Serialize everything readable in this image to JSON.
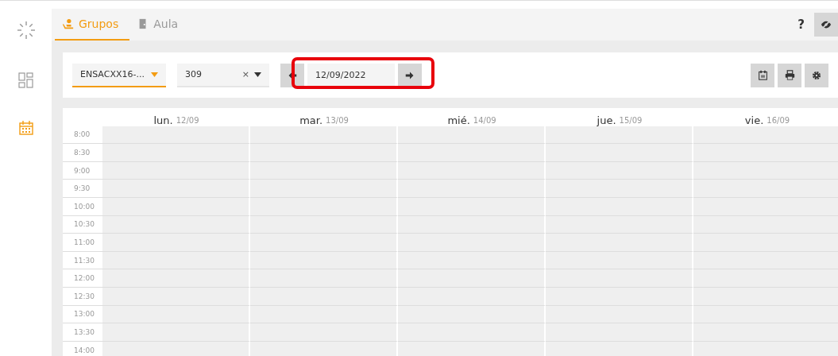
{
  "tabs": [
    {
      "label": "Grupos",
      "kind": "group",
      "selected": true
    },
    {
      "label": "Aula",
      "kind": "door",
      "selected": false
    }
  ],
  "top_actions": {
    "help": "?"
  },
  "toolbar": {
    "group_select": {
      "value": "ENSACXX16-..."
    },
    "classroom_select": {
      "value": "309",
      "clear": "×"
    },
    "date_nav": {
      "value": "12/09/2022"
    }
  },
  "annotation": {
    "kind": "frame"
  },
  "calendar": {
    "days": [
      {
        "name": "lun.",
        "date": "12/09"
      },
      {
        "name": "mar.",
        "date": "13/09"
      },
      {
        "name": "mié.",
        "date": "14/09"
      },
      {
        "name": "jue.",
        "date": "15/09"
      },
      {
        "name": "vie.",
        "date": "16/09"
      }
    ],
    "times": [
      "8:00",
      "8:30",
      "9:00",
      "9:30",
      "10:00",
      "10:30",
      "11:00",
      "11:30",
      "12:00",
      "12:30",
      "13:00",
      "13:30",
      "14:00"
    ]
  }
}
